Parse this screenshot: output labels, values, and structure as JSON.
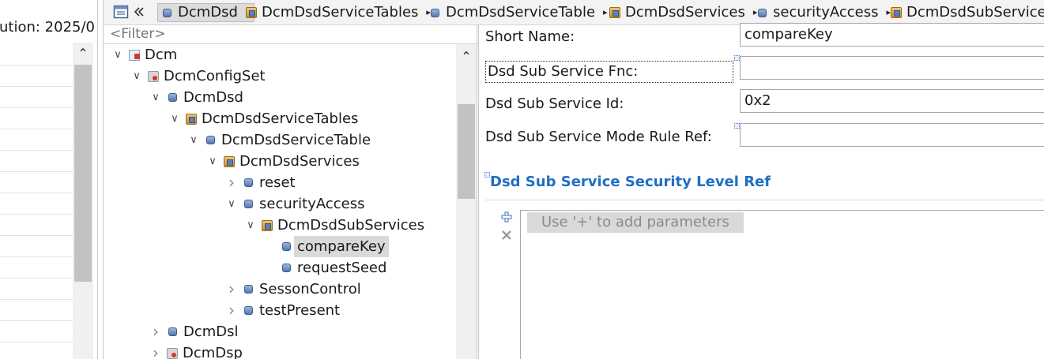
{
  "left_pane": {
    "header_text": "ution: 2025/0"
  },
  "tree": {
    "filter_placeholder": "<Filter>",
    "nodes": [
      {
        "label": "Dcm",
        "twisty": "open"
      },
      {
        "label": "DcmConfigSet",
        "twisty": "open"
      },
      {
        "label": "DcmDsd",
        "twisty": "open"
      },
      {
        "label": "DcmDsdServiceTables",
        "twisty": "open"
      },
      {
        "label": "DcmDsdServiceTable",
        "twisty": "open"
      },
      {
        "label": "DcmDsdServices",
        "twisty": "open"
      },
      {
        "label": "reset",
        "twisty": "closed"
      },
      {
        "label": "securityAccess",
        "twisty": "open"
      },
      {
        "label": "DcmDsdSubServices",
        "twisty": "open"
      },
      {
        "label": "compareKey",
        "twisty": "none",
        "selected": true
      },
      {
        "label": "requestSeed",
        "twisty": "none"
      },
      {
        "label": "SessonControl",
        "twisty": "closed"
      },
      {
        "label": "testPresent",
        "twisty": "closed"
      },
      {
        "label": "DcmDsl",
        "twisty": "closed"
      },
      {
        "label": "DcmDsp",
        "twisty": "closed"
      }
    ]
  },
  "breadcrumb": {
    "items": [
      "DcmDsd",
      "DcmDsdServiceTables",
      "DcmDsdServiceTable",
      "DcmDsdServices",
      "securityAccess",
      "DcmDsdSubServices"
    ]
  },
  "properties": {
    "short_name_label": "Short Name:",
    "short_name_value": "compareKey",
    "sub_service_fnc_label": "Dsd Sub Service Fnc:",
    "sub_service_fnc_value": "",
    "sub_service_id_label": "Dsd Sub Service Id:",
    "sub_service_id_value": "0x2",
    "mode_rule_ref_label": "Dsd Sub Service Mode Rule Ref:",
    "mode_rule_ref_value": "",
    "security_section_title": "Dsd Sub Service Security Level Ref",
    "param_hint": "Use '+' to add parameters"
  },
  "icons": {
    "add": "plus-icon",
    "remove": "x-icon",
    "toolbar": "window-icon",
    "collapse": "double-chevron-left-icon"
  }
}
